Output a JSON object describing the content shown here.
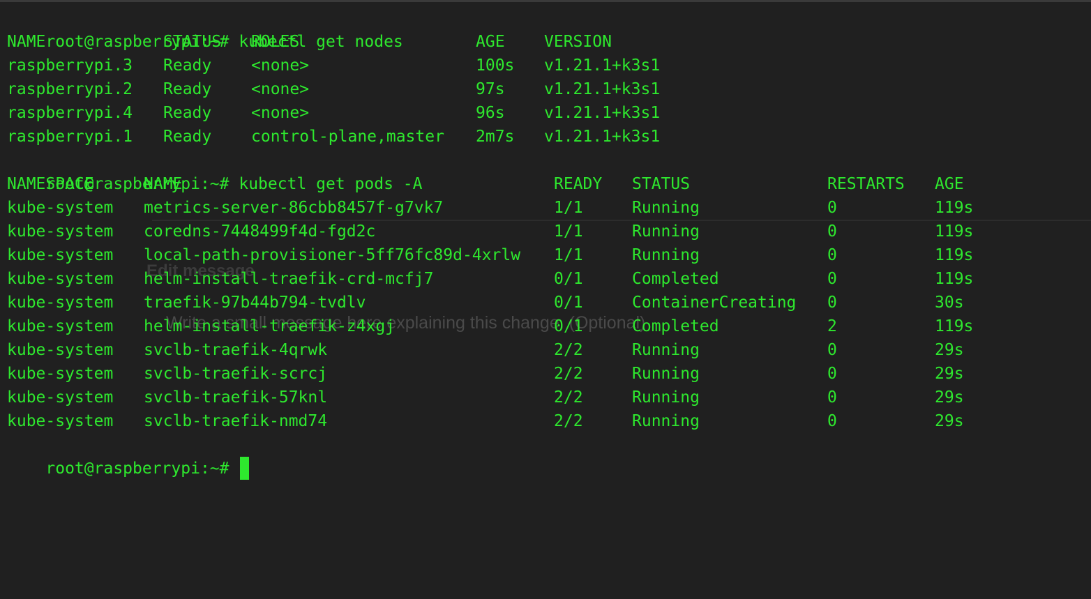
{
  "prompt": "root@raspberrypi:~#",
  "commands": {
    "nodes": "kubectl get nodes",
    "pods": "kubectl get pods -A"
  },
  "nodes_table": {
    "headers": [
      "NAME",
      "STATUS",
      "ROLES",
      "AGE",
      "VERSION"
    ],
    "rows": [
      [
        "raspberrypi.3",
        "Ready",
        "<none>",
        "100s",
        "v1.21.1+k3s1"
      ],
      [
        "raspberrypi.2",
        "Ready",
        "<none>",
        "97s",
        "v1.21.1+k3s1"
      ],
      [
        "raspberrypi.4",
        "Ready",
        "<none>",
        "96s",
        "v1.21.1+k3s1"
      ],
      [
        "raspberrypi.1",
        "Ready",
        "control-plane,master",
        "2m7s",
        "v1.21.1+k3s1"
      ]
    ]
  },
  "pods_table": {
    "headers": [
      "NAMESPACE",
      "NAME",
      "READY",
      "STATUS",
      "RESTARTS",
      "AGE"
    ],
    "rows": [
      [
        "kube-system",
        "metrics-server-86cbb8457f-g7vk7",
        "1/1",
        "Running",
        "0",
        "119s"
      ],
      [
        "kube-system",
        "coredns-7448499f4d-fgd2c",
        "1/1",
        "Running",
        "0",
        "119s"
      ],
      [
        "kube-system",
        "local-path-provisioner-5ff76fc89d-4xrlw",
        "1/1",
        "Running",
        "0",
        "119s"
      ],
      [
        "kube-system",
        "helm-install-traefik-crd-mcfj7",
        "0/1",
        "Completed",
        "0",
        "119s"
      ],
      [
        "kube-system",
        "traefik-97b44b794-tvdlv",
        "0/1",
        "ContainerCreating",
        "0",
        "30s"
      ],
      [
        "kube-system",
        "helm-install-traefik-z4xgj",
        "0/1",
        "Completed",
        "2",
        "119s"
      ],
      [
        "kube-system",
        "svclb-traefik-4qrwk",
        "2/2",
        "Running",
        "0",
        "29s"
      ],
      [
        "kube-system",
        "svclb-traefik-scrcj",
        "2/2",
        "Running",
        "0",
        "29s"
      ],
      [
        "kube-system",
        "svclb-traefik-57knl",
        "2/2",
        "Running",
        "0",
        "29s"
      ],
      [
        "kube-system",
        "svclb-traefik-nmd74",
        "2/2",
        "Running",
        "0",
        "29s"
      ]
    ]
  },
  "ghost": {
    "title": "Edit message",
    "text": "Write a small message here explaining this change. (Optional)"
  },
  "colors": {
    "background": "#202020",
    "text": "#2ee82e"
  }
}
